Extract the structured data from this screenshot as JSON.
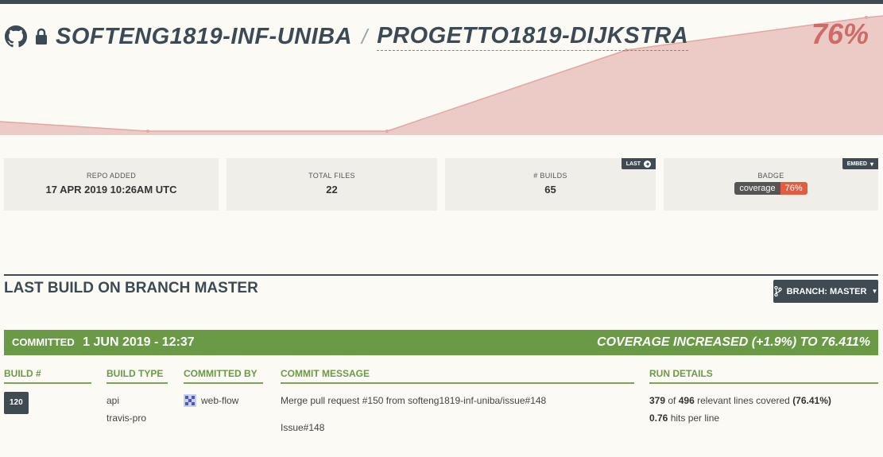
{
  "repo": {
    "org": "SOFTENG1819-INF-UNIBA",
    "separator": "/",
    "name": "PROGETTO1819-DIJKSTRA",
    "coverage": "76%"
  },
  "colors": {
    "dark": "#3f4a52",
    "green": "#6a9a45",
    "coverage_red": "#cf6b66",
    "chart_fill": "#eccac6"
  },
  "stats": {
    "repo_added": {
      "label": "REPO ADDED",
      "value": "17 APR 2019 10:26AM UTC"
    },
    "total_files": {
      "label": "TOTAL FILES",
      "value": "22"
    },
    "builds": {
      "label": "# BUILDS",
      "value": "65",
      "button": "LAST"
    },
    "badge": {
      "label": "BADGE",
      "left": "coverage",
      "right": "76%",
      "button": "EMBED"
    }
  },
  "section": {
    "title": "LAST BUILD ON BRANCH MASTER",
    "branch_button": "BRANCH: MASTER"
  },
  "build": {
    "committed_label": "COMMITTED",
    "committed_date": "1 JUN 2019 - 12:37",
    "coverage_change": "COVERAGE INCREASED (+1.9%) TO 76.411%",
    "headers": {
      "build_num": "BUILD #",
      "build_type": "BUILD TYPE",
      "committed_by": "COMMITTED BY",
      "commit_message": "COMMIT MESSAGE",
      "run_details": "RUN DETAILS"
    },
    "build_number": "120",
    "build_type_1": "api",
    "build_type_2": "travis-pro",
    "committer": "web-flow",
    "commit_message_1": "Merge pull request #150 from softeng1819-inf-uniba/issue#148",
    "commit_message_2": "Issue#148",
    "lines_covered": "379",
    "lines_of": "of",
    "lines_total": "496",
    "lines_text": "relevant lines covered",
    "lines_pct": "(76.41%)",
    "hits": "0.76",
    "hits_text": "hits per line"
  }
}
